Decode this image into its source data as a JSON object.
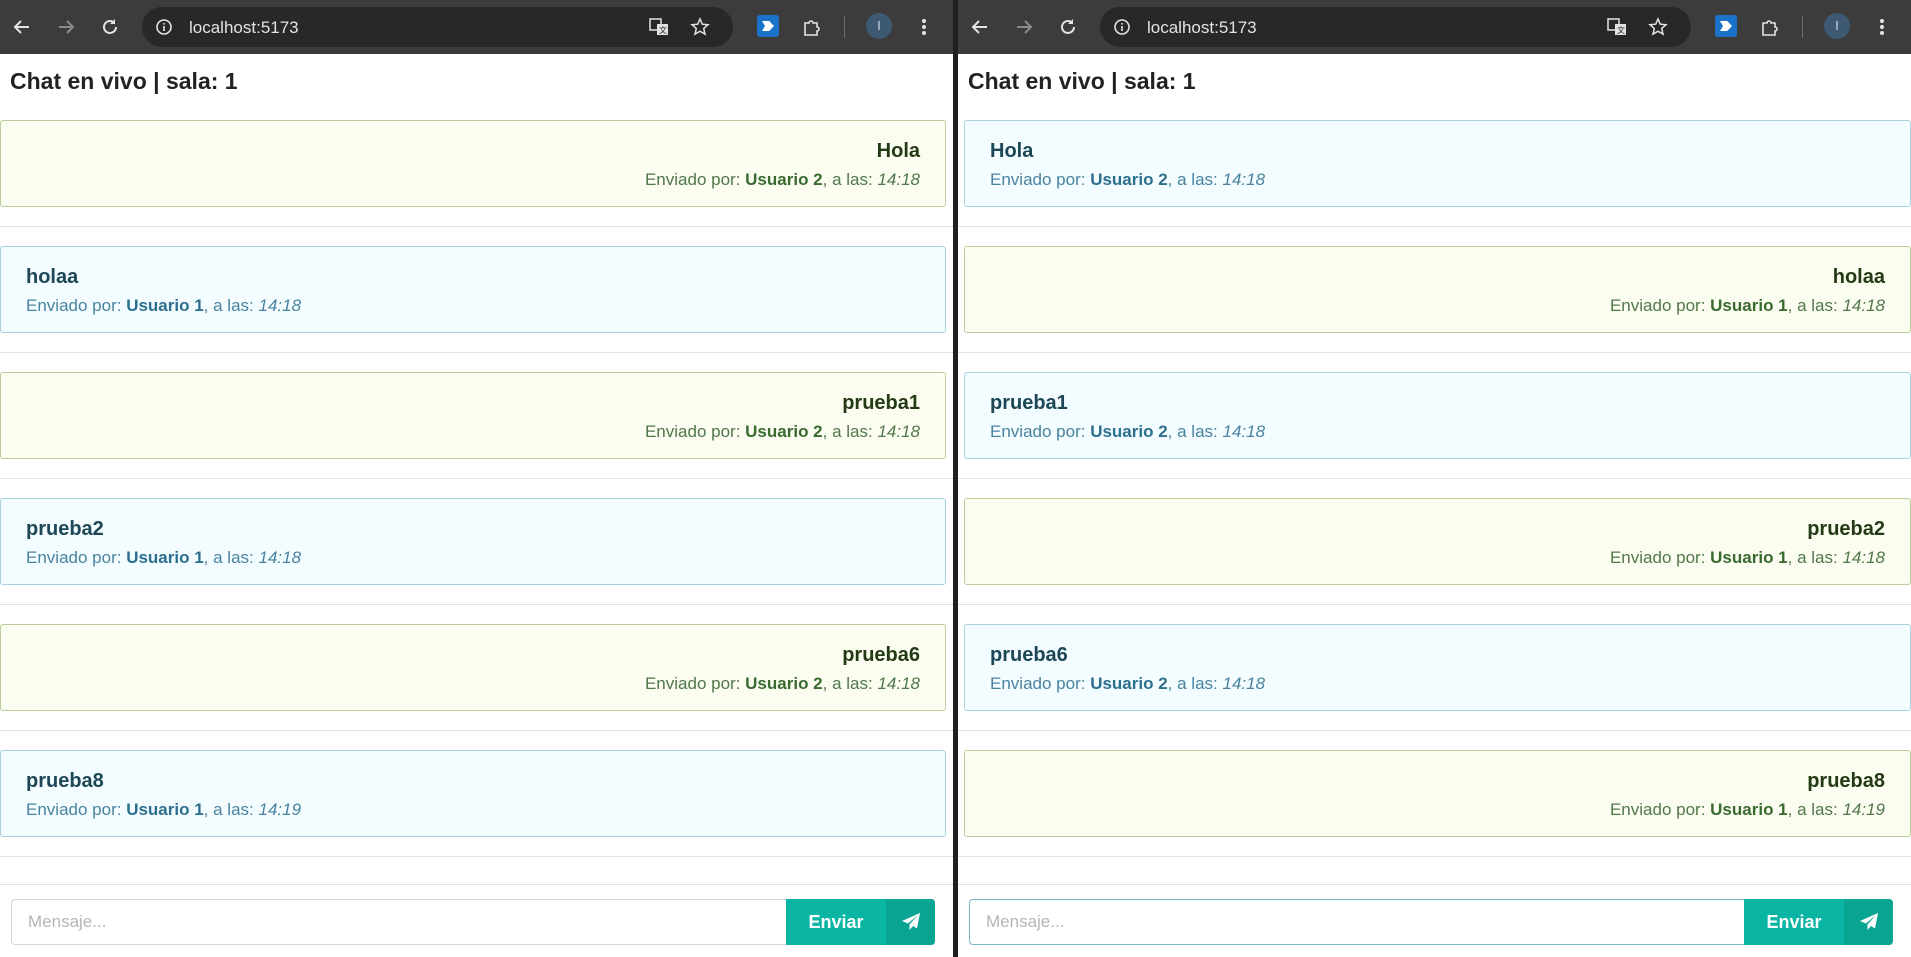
{
  "browser": {
    "url": "localhost:5173",
    "profile_initial": "I"
  },
  "chat": {
    "title": "Chat en vivo | sala: 1",
    "meta_prefix": "Enviado por: ",
    "meta_middle": ", a las: "
  },
  "windows": [
    {
      "messages": [
        {
          "text": "Hola",
          "user": "Usuario 2",
          "time": "14:18",
          "side": "mine"
        },
        {
          "text": "holaa",
          "user": "Usuario 1",
          "time": "14:18",
          "side": "other"
        },
        {
          "text": "prueba1",
          "user": "Usuario 2",
          "time": "14:18",
          "side": "mine"
        },
        {
          "text": "prueba2",
          "user": "Usuario 1",
          "time": "14:18",
          "side": "other"
        },
        {
          "text": "prueba6",
          "user": "Usuario 2",
          "time": "14:18",
          "side": "mine"
        },
        {
          "text": "prueba8",
          "user": "Usuario 1",
          "time": "14:19",
          "side": "other"
        }
      ],
      "input": {
        "placeholder": "Mensaje...",
        "value": "",
        "focused": false
      },
      "send_label": "Enviar"
    },
    {
      "messages": [
        {
          "text": "Hola",
          "user": "Usuario 2",
          "time": "14:18",
          "side": "other"
        },
        {
          "text": "holaa",
          "user": "Usuario 1",
          "time": "14:18",
          "side": "mine"
        },
        {
          "text": "prueba1",
          "user": "Usuario 2",
          "time": "14:18",
          "side": "other"
        },
        {
          "text": "prueba2",
          "user": "Usuario 1",
          "time": "14:18",
          "side": "mine"
        },
        {
          "text": "prueba6",
          "user": "Usuario 2",
          "time": "14:18",
          "side": "other"
        },
        {
          "text": "prueba8",
          "user": "Usuario 1",
          "time": "14:19",
          "side": "mine"
        }
      ],
      "input": {
        "placeholder": "Mensaje...",
        "value": "",
        "focused": true
      },
      "send_label": "Enviar"
    }
  ],
  "colors": {
    "mine_bg": "#fafdf0",
    "other_bg": "#f3fcfe",
    "send_button": "#0bb5a4",
    "toolbar": "#3c3c3c"
  },
  "icons": [
    "back-arrow-icon",
    "forward-arrow-icon",
    "reload-icon",
    "site-info-icon",
    "translate-icon",
    "star-icon",
    "extension-icon",
    "puzzle-icon",
    "kebab-menu-icon",
    "paper-plane-icon"
  ]
}
